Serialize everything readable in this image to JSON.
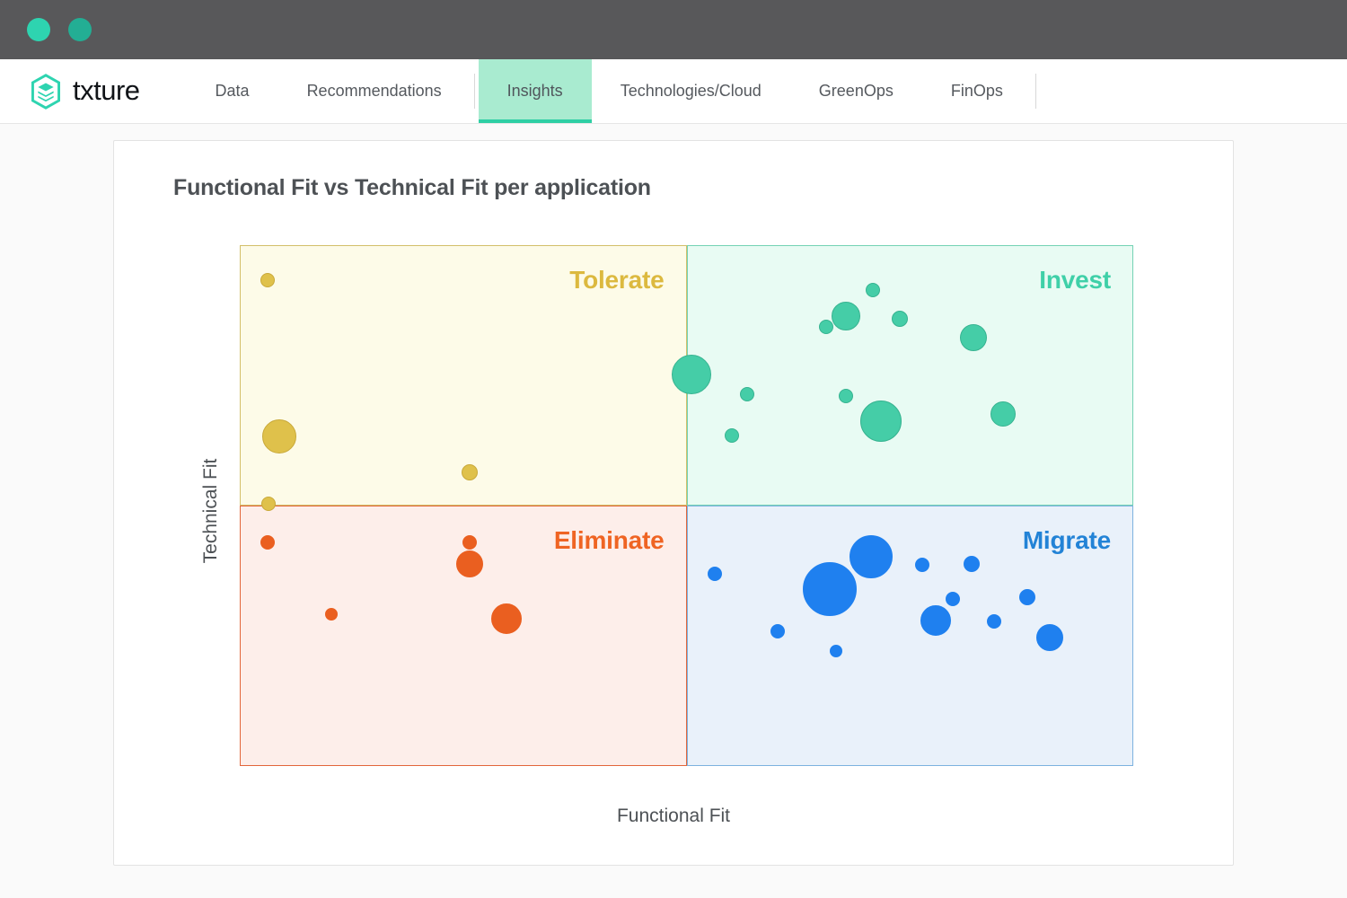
{
  "window": {
    "dots": [
      "window-dot-1",
      "window-dot-2"
    ]
  },
  "brand": {
    "name": "txture",
    "logo_color": "#2ed4b0"
  },
  "nav": {
    "items": [
      {
        "label": "Data",
        "active": false
      },
      {
        "label": "Recommendations",
        "active": false
      },
      {
        "label": "Insights",
        "active": true
      },
      {
        "label": "Technologies/Cloud",
        "active": false
      },
      {
        "label": "GreenOps",
        "active": false
      },
      {
        "label": "FinOps",
        "active": false
      }
    ],
    "active_bg": "#a9ebd0",
    "active_underline": "#2ecfa4"
  },
  "card": {
    "title": "Functional Fit vs Technical Fit per application"
  },
  "chart_data": {
    "type": "scatter",
    "title": "Functional Fit vs Technical Fit per application",
    "xlabel": "Functional Fit",
    "ylabel": "Technical Fit",
    "xlim": [
      0,
      100
    ],
    "ylim": [
      0,
      100
    ],
    "grid": false,
    "legend": "none",
    "quadrants": [
      {
        "key": "tolerate",
        "label": "Tolerate",
        "x_range": [
          0,
          50
        ],
        "y_range": [
          50,
          100
        ],
        "fill": "#fdfbe8",
        "border": "#d3bf6a",
        "label_color": "#dcb93f",
        "bubble_color": "#dfc14b"
      },
      {
        "key": "invest",
        "label": "Invest",
        "x_range": [
          50,
          100
        ],
        "y_range": [
          50,
          100
        ],
        "fill": "#e8fbf3",
        "border": "#74d2b4",
        "label_color": "#3fd0a8",
        "bubble_color": "#45cda7"
      },
      {
        "key": "eliminate",
        "label": "Eliminate",
        "x_range": [
          0,
          50
        ],
        "y_range": [
          0,
          50
        ],
        "fill": "#fdeeea",
        "border": "#e2663b",
        "label_color": "#ef6423",
        "bubble_color": "#ea5f20"
      },
      {
        "key": "migrate",
        "label": "Migrate",
        "x_range": [
          50,
          100
        ],
        "y_range": [
          0,
          50
        ],
        "fill": "#e9f1fa",
        "border": "#7db2df",
        "label_color": "#2383d6",
        "bubble_color": "#1f80ef"
      }
    ],
    "series": [
      {
        "name": "Tolerate",
        "quadrant": "tolerate",
        "color": "#dfc14b",
        "points": [
          {
            "x": 3.1,
            "y": 93.3,
            "r": 8
          },
          {
            "x": 4.4,
            "y": 63.3,
            "r": 19
          },
          {
            "x": 25.7,
            "y": 56.4,
            "r": 9
          },
          {
            "x": 3.2,
            "y": 50.4,
            "r": 8
          }
        ]
      },
      {
        "name": "Invest",
        "quadrant": "invest",
        "color": "#45cda7",
        "points": [
          {
            "x": 50.6,
            "y": 75.2,
            "r": 22
          },
          {
            "x": 70.9,
            "y": 91.4,
            "r": 8
          },
          {
            "x": 67.8,
            "y": 86.3,
            "r": 16
          },
          {
            "x": 73.9,
            "y": 85.8,
            "r": 9
          },
          {
            "x": 65.6,
            "y": 84.3,
            "r": 8
          },
          {
            "x": 82.1,
            "y": 82.3,
            "r": 15
          },
          {
            "x": 56.8,
            "y": 71.4,
            "r": 8
          },
          {
            "x": 67.8,
            "y": 71.1,
            "r": 8
          },
          {
            "x": 71.8,
            "y": 66.2,
            "r": 23
          },
          {
            "x": 85.4,
            "y": 67.6,
            "r": 14
          },
          {
            "x": 55.1,
            "y": 63.5,
            "r": 8
          }
        ]
      },
      {
        "name": "Eliminate",
        "quadrant": "eliminate",
        "color": "#ea5f20",
        "points": [
          {
            "x": 3.1,
            "y": 42.9,
            "r": 8
          },
          {
            "x": 25.7,
            "y": 42.9,
            "r": 8
          },
          {
            "x": 25.7,
            "y": 38.8,
            "r": 15
          },
          {
            "x": 10.3,
            "y": 29.2,
            "r": 7
          },
          {
            "x": 29.8,
            "y": 28.2,
            "r": 17
          }
        ]
      },
      {
        "name": "Migrate",
        "quadrant": "migrate",
        "color": "#1f80ef",
        "points": [
          {
            "x": 70.7,
            "y": 40.2,
            "r": 24
          },
          {
            "x": 76.4,
            "y": 38.6,
            "r": 8
          },
          {
            "x": 81.9,
            "y": 38.8,
            "r": 9
          },
          {
            "x": 53.2,
            "y": 36.9,
            "r": 8
          },
          {
            "x": 66.0,
            "y": 34.0,
            "r": 30
          },
          {
            "x": 88.1,
            "y": 32.4,
            "r": 9
          },
          {
            "x": 79.8,
            "y": 32.0,
            "r": 8
          },
          {
            "x": 77.9,
            "y": 27.9,
            "r": 17
          },
          {
            "x": 84.4,
            "y": 27.7,
            "r": 8
          },
          {
            "x": 60.2,
            "y": 25.9,
            "r": 8
          },
          {
            "x": 90.7,
            "y": 24.6,
            "r": 15
          },
          {
            "x": 66.7,
            "y": 22.0,
            "r": 7
          }
        ]
      }
    ]
  }
}
